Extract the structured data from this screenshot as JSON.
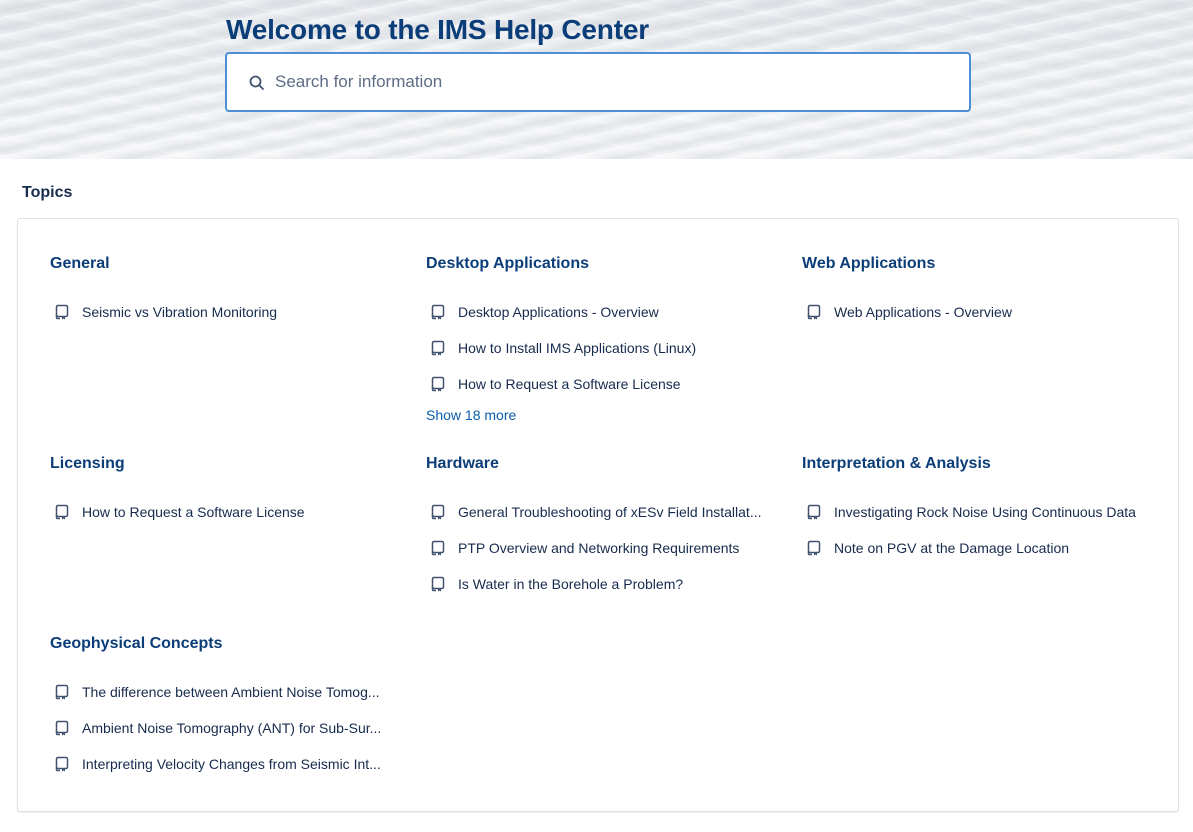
{
  "hero": {
    "title": "Welcome to the IMS Help Center",
    "search_placeholder": "Search for information"
  },
  "topics": {
    "heading": "Topics",
    "groups": [
      {
        "title": "General",
        "articles": [
          "Seismic vs Vibration Monitoring"
        ]
      },
      {
        "title": "Desktop Applications",
        "articles": [
          "Desktop Applications - Overview",
          "How to Install IMS Applications (Linux)",
          "How to Request a Software License"
        ],
        "show_more": "Show 18 more"
      },
      {
        "title": "Web Applications",
        "articles": [
          "Web Applications - Overview"
        ]
      },
      {
        "title": "Licensing",
        "articles": [
          "How to Request a Software License"
        ]
      },
      {
        "title": "Hardware",
        "articles": [
          "General Troubleshooting of xESv Field Installat...",
          "PTP Overview and Networking Requirements",
          "Is Water in the Borehole a Problem?"
        ]
      },
      {
        "title": "Interpretation & Analysis",
        "articles": [
          "Investigating Rock Noise Using Continuous Data",
          "Note on PGV at the Damage Location"
        ]
      },
      {
        "title": "Geophysical Concepts",
        "articles": [
          "The difference between Ambient Noise Tomog...",
          "Ambient Noise Tomography (ANT) for Sub-Sur...",
          "Interpreting Velocity Changes from Seismic Int..."
        ]
      }
    ]
  },
  "icons": {
    "search": "search-icon",
    "article": "knowledge-article-icon"
  },
  "colors": {
    "title": "#0b3d78",
    "link": "#0b5cad",
    "text": "#172b4d",
    "search_border": "#4c8fd6"
  }
}
